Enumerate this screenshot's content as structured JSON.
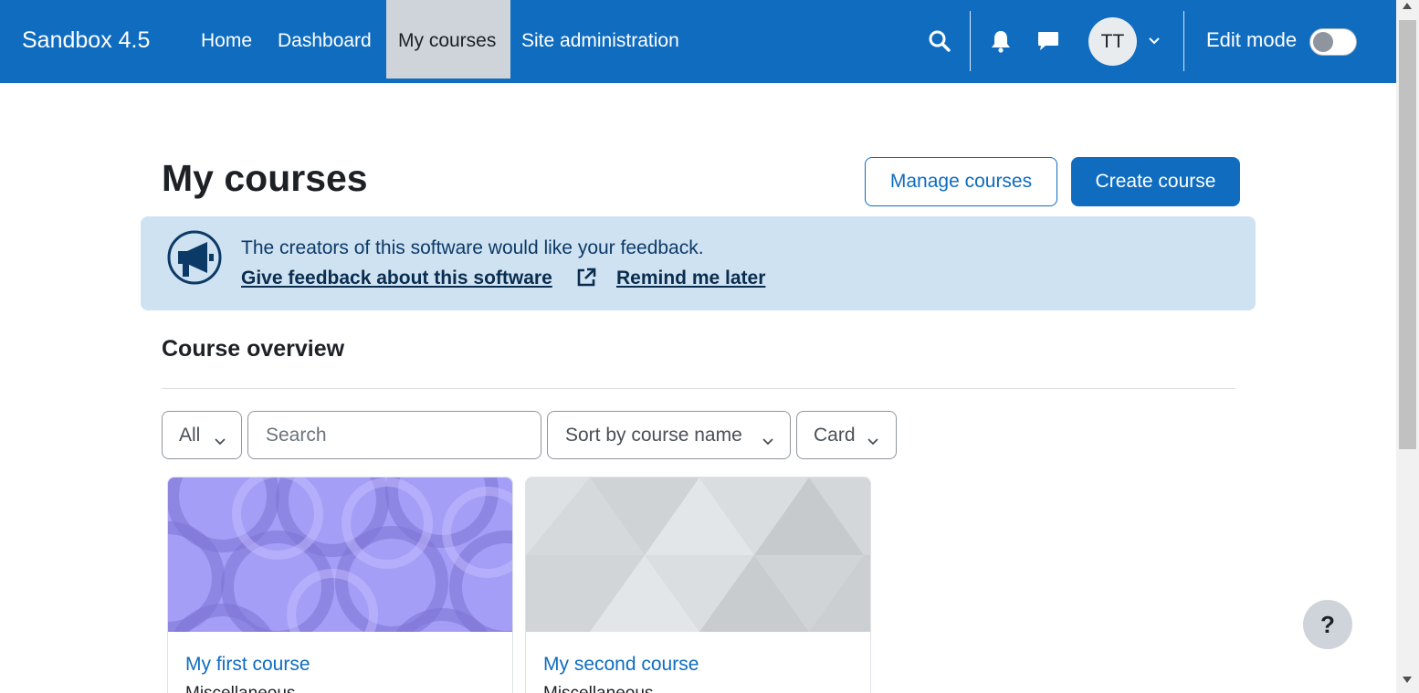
{
  "navbar": {
    "brand": "Sandbox 4.5",
    "links": [
      {
        "label": "Home"
      },
      {
        "label": "Dashboard"
      },
      {
        "label": "My courses"
      },
      {
        "label": "Site administration"
      }
    ],
    "avatar_initials": "TT",
    "edit_mode_label": "Edit mode",
    "edit_mode_on": false,
    "icons": [
      "search-icon",
      "bell-icon",
      "chat-icon",
      "chevron-down-icon"
    ]
  },
  "header": {
    "title": "My courses",
    "manage_button": "Manage courses",
    "create_button": "Create course"
  },
  "feedback": {
    "message": "The creators of this software would like your feedback.",
    "give_link": "Give feedback about this software",
    "remind_link": "Remind me later"
  },
  "overview": {
    "title": "Course overview",
    "filter_value": "All",
    "search_placeholder": "Search",
    "sort_value": "Sort by course name",
    "view_value": "Card"
  },
  "courses": [
    {
      "name": "My first course",
      "category": "Miscellaneous"
    },
    {
      "name": "My second course",
      "category": "Miscellaneous"
    }
  ],
  "help_button": "?",
  "colors": {
    "brand": "#0f6cbf",
    "alert_bg": "#cfe2f2",
    "active_nav_bg": "#ced4da"
  }
}
